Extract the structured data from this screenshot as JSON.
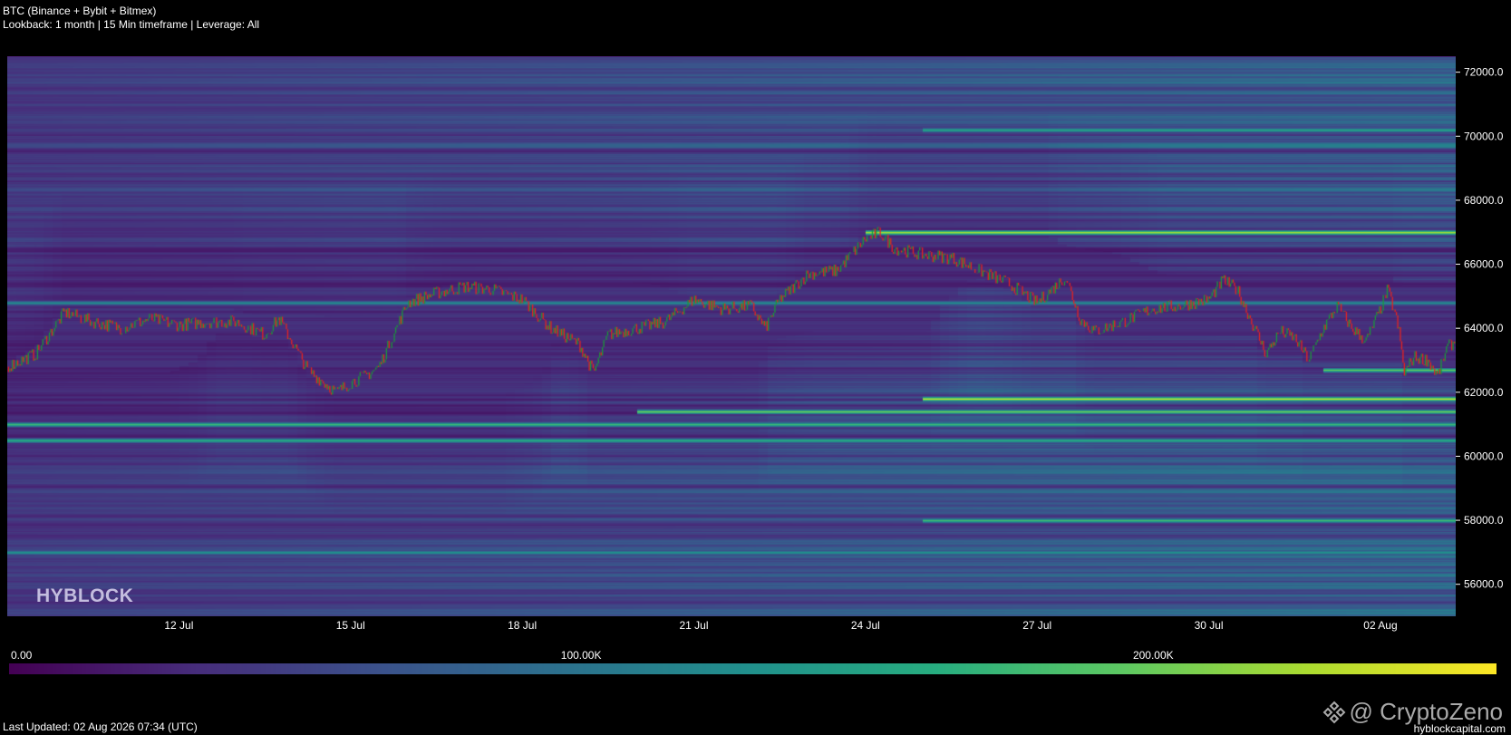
{
  "header": {
    "title": "BTC (Binance + Bybit + Bitmex)",
    "subtitle": "Lookback: 1 month | 15 Min timeframe | Leverage: All"
  },
  "brand_text": "HYBLOCK",
  "footer": {
    "last_updated": "Last Updated: 02 Aug 2026 07:34 (UTC)",
    "watermark": "@ CryptoZeno",
    "watermark_icon": "binance-diamond-icon",
    "site": "hyblockcapital.com"
  },
  "colors": {
    "background": "#000000",
    "candle_up": "#1a9a3a",
    "candle_down": "#e8231f",
    "colorscale": [
      "#440154",
      "#472d7b",
      "#3b528b",
      "#2c728e",
      "#21918c",
      "#28ae80",
      "#5ec962",
      "#addc30",
      "#fde725"
    ]
  },
  "chart_data": {
    "type": "heatmap",
    "description_overlay": "price line (candles) over liquidation heatmap",
    "x": {
      "start": "2026-07-09",
      "end": "2026-08-02 07:34",
      "ticks": [
        "12 Jul",
        "15 Jul",
        "18 Jul",
        "21 Jul",
        "24 Jul",
        "27 Jul",
        "30 Jul",
        "02 Aug"
      ]
    },
    "y": {
      "range": [
        55000,
        72500
      ],
      "ticks": [
        72000.0,
        70000.0,
        68000.0,
        66000.0,
        64000.0,
        62000.0,
        60000.0,
        58000.0,
        56000.0
      ],
      "tick_labels": [
        "72000.0",
        "70000.0",
        "68000.0",
        "66000.0",
        "64000.0",
        "62000.0",
        "60000.0",
        "58000.0",
        "56000.0"
      ]
    },
    "colorbar": {
      "range": [
        0,
        260000
      ],
      "ticks": [
        0,
        100000,
        200000
      ],
      "tick_labels": [
        "0.00",
        "100.00K",
        "200.00K"
      ]
    },
    "price_path": [
      [
        "2026-07-09 00:00",
        62800
      ],
      [
        "2026-07-09 12:00",
        63200
      ],
      [
        "2026-07-10 00:00",
        64500
      ],
      [
        "2026-07-10 12:00",
        64200
      ],
      [
        "2026-07-11 00:00",
        64000
      ],
      [
        "2026-07-11 12:00",
        64300
      ],
      [
        "2026-07-12 00:00",
        64100
      ],
      [
        "2026-07-12 12:00",
        64200
      ],
      [
        "2026-07-13 00:00",
        64200
      ],
      [
        "2026-07-13 12:00",
        63800
      ],
      [
        "2026-07-13 18:00",
        64300
      ],
      [
        "2026-07-14 06:00",
        62700
      ],
      [
        "2026-07-14 18:00",
        62000
      ],
      [
        "2026-07-15 00:00",
        62300
      ],
      [
        "2026-07-15 06:00",
        62500
      ],
      [
        "2026-07-15 12:00",
        62800
      ],
      [
        "2026-07-16 00:00",
        64800
      ],
      [
        "2026-07-16 12:00",
        65100
      ],
      [
        "2026-07-17 00:00",
        65300
      ],
      [
        "2026-07-17 12:00",
        65200
      ],
      [
        "2026-07-18 00:00",
        64900
      ],
      [
        "2026-07-18 12:00",
        64000
      ],
      [
        "2026-07-19 00:00",
        63500
      ],
      [
        "2026-07-19 06:00",
        62600
      ],
      [
        "2026-07-19 12:00",
        63800
      ],
      [
        "2026-07-20 00:00",
        64000
      ],
      [
        "2026-07-20 12:00",
        64200
      ],
      [
        "2026-07-21 00:00",
        64900
      ],
      [
        "2026-07-21 12:00",
        64600
      ],
      [
        "2026-07-22 00:00",
        64700
      ],
      [
        "2026-07-22 06:00",
        64000
      ],
      [
        "2026-07-22 12:00",
        64900
      ],
      [
        "2026-07-23 00:00",
        65700
      ],
      [
        "2026-07-23 12:00",
        65800
      ],
      [
        "2026-07-24 00:00",
        66800
      ],
      [
        "2026-07-24 06:00",
        67000
      ],
      [
        "2026-07-24 12:00",
        66500
      ],
      [
        "2026-07-25 00:00",
        66300
      ],
      [
        "2026-07-25 12:00",
        66200
      ],
      [
        "2026-07-26 00:00",
        65800
      ],
      [
        "2026-07-26 12:00",
        65400
      ],
      [
        "2026-07-27 00:00",
        64800
      ],
      [
        "2026-07-27 12:00",
        65600
      ],
      [
        "2026-07-27 18:00",
        64300
      ],
      [
        "2026-07-28 00:00",
        63900
      ],
      [
        "2026-07-28 12:00",
        64200
      ],
      [
        "2026-07-29 00:00",
        64600
      ],
      [
        "2026-07-29 12:00",
        64700
      ],
      [
        "2026-07-30 00:00",
        64900
      ],
      [
        "2026-07-30 06:00",
        65500
      ],
      [
        "2026-07-30 12:00",
        65200
      ],
      [
        "2026-07-30 18:00",
        64200
      ],
      [
        "2026-07-31 00:00",
        63200
      ],
      [
        "2026-07-31 06:00",
        63900
      ],
      [
        "2026-07-31 12:00",
        63700
      ],
      [
        "2026-07-31 18:00",
        63000
      ],
      [
        "2026-08-01 00:00",
        64000
      ],
      [
        "2026-08-01 06:00",
        64700
      ],
      [
        "2026-08-01 12:00",
        64000
      ],
      [
        "2026-08-01 18:00",
        63600
      ],
      [
        "2026-08-02 00:00",
        64600
      ],
      [
        "2026-08-02 03:00",
        65200
      ],
      [
        "2026-08-02 06:00",
        64500
      ],
      [
        "2026-08-02 08:00",
        63800
      ],
      [
        "2026-08-02 10:00",
        62600
      ],
      [
        "2026-08-02 14:00",
        63100
      ],
      [
        "2026-08-02 20:00",
        63000
      ],
      [
        "2026-08-03 00:00",
        62500
      ],
      [
        "2026-08-03 04:00",
        63400
      ],
      [
        "2026-08-03 07:34",
        63600
      ]
    ],
    "liquidity_bands": [
      {
        "price": 67000,
        "intensity": 0.92,
        "from": "2026-07-24"
      },
      {
        "price": 62700,
        "intensity": 0.78,
        "from": "2026-08-01"
      },
      {
        "price": 61800,
        "intensity": 0.95,
        "from": "2026-07-25"
      },
      {
        "price": 61400,
        "intensity": 0.8,
        "from": "2026-07-20"
      },
      {
        "price": 61000,
        "intensity": 0.7,
        "from": "2026-07-09"
      },
      {
        "price": 60500,
        "intensity": 0.66,
        "from": "2026-07-09"
      },
      {
        "price": 58000,
        "intensity": 0.7,
        "from": "2026-07-25"
      },
      {
        "price": 57000,
        "intensity": 0.55,
        "from": "2026-07-09"
      },
      {
        "price": 70200,
        "intensity": 0.62,
        "from": "2026-07-25"
      },
      {
        "price": 64800,
        "intensity": 0.5,
        "from": "2026-07-09"
      }
    ]
  }
}
